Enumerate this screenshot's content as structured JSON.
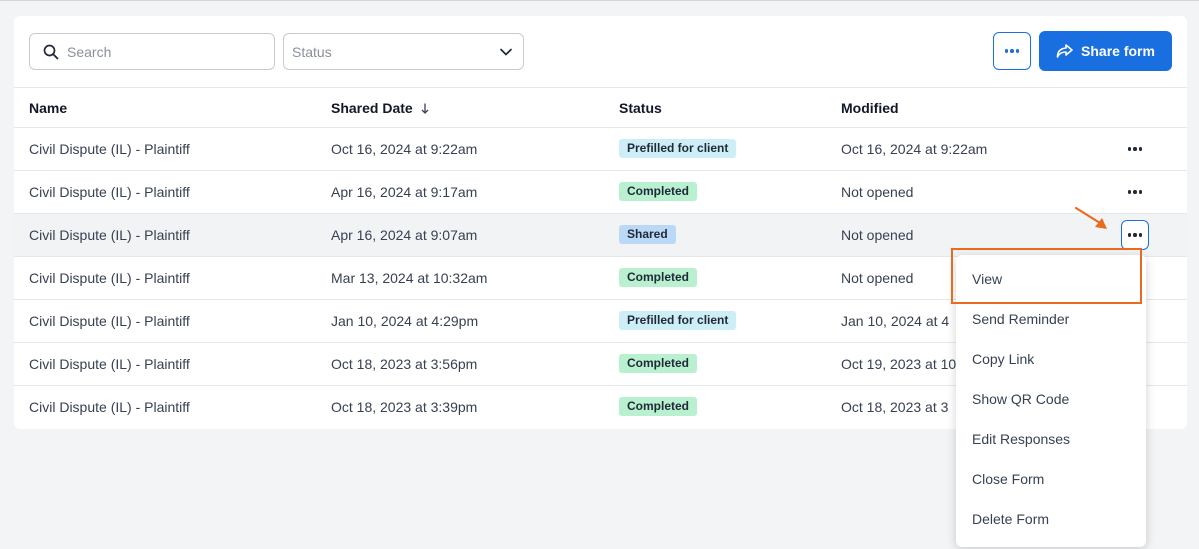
{
  "toolbar": {
    "search_placeholder": "Search",
    "status_placeholder": "Status",
    "share_label": "Share form"
  },
  "table": {
    "columns": [
      "Name",
      "Shared Date",
      "Status",
      "Modified"
    ],
    "rows": [
      {
        "name": "Civil Dispute (IL) - Plaintiff",
        "shared": "Oct 16, 2024 at 9:22am",
        "status": "Prefilled for client",
        "status_kind": "prefilled",
        "modified": "Oct 16, 2024 at 9:22am"
      },
      {
        "name": "Civil Dispute (IL) - Plaintiff",
        "shared": "Apr 16, 2024 at 9:17am",
        "status": "Completed",
        "status_kind": "completed",
        "modified": "Not opened"
      },
      {
        "name": "Civil Dispute (IL) - Plaintiff",
        "shared": "Apr 16, 2024 at 9:07am",
        "status": "Shared",
        "status_kind": "shared",
        "modified": "Not opened"
      },
      {
        "name": "Civil Dispute (IL) - Plaintiff",
        "shared": "Mar 13, 2024 at 10:32am",
        "status": "Completed",
        "status_kind": "completed",
        "modified": "Not opened"
      },
      {
        "name": "Civil Dispute (IL) - Plaintiff",
        "shared": "Jan 10, 2024 at 4:29pm",
        "status": "Prefilled for client",
        "status_kind": "prefilled",
        "modified": "Jan 10, 2024 at 4"
      },
      {
        "name": "Civil Dispute (IL) - Plaintiff",
        "shared": "Oct 18, 2023 at 3:56pm",
        "status": "Completed",
        "status_kind": "completed",
        "modified": "Oct 19, 2023 at 10"
      },
      {
        "name": "Civil Dispute (IL) - Plaintiff",
        "shared": "Oct 18, 2023 at 3:39pm",
        "status": "Completed",
        "status_kind": "completed",
        "modified": "Oct 18, 2023 at 3"
      }
    ]
  },
  "menu": {
    "items": [
      "View",
      "Send Reminder",
      "Copy Link",
      "Show QR Code",
      "Edit Responses",
      "Close Form",
      "Delete Form"
    ]
  },
  "colors": {
    "accent": "#1a6fe0",
    "annotation": "#ea6a1e",
    "completed_badge": "#b8f0d0",
    "prefilled_badge": "#cdeef6",
    "shared_badge": "#bcd8f7"
  }
}
